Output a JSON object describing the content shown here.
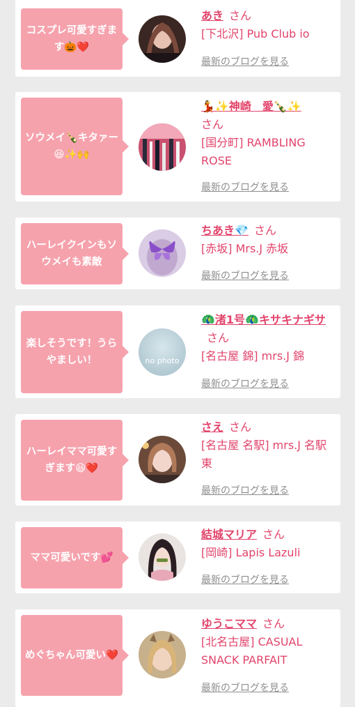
{
  "cards": [
    {
      "comment": "コスプレ可愛すぎます🎃❤️",
      "name": "あき",
      "san": "さん",
      "shop": "[下北沢] Pub Club io",
      "blog": "最新のブログを見る"
    },
    {
      "comment": "ソウメイ🍾キタァー😆✨🙌",
      "name": "💃✨神崎　愛🍾✨",
      "san": "さん",
      "shop": "[国分町] RAMBLING ROSE",
      "blog": "最新のブログを見る"
    },
    {
      "comment": "ハーレイクインもソウメイも素敵",
      "name": "ちあき💎",
      "san": "さん",
      "shop": "[赤坂] Mrs.J 赤坂",
      "blog": "最新のブログを見る"
    },
    {
      "comment": "楽しそうです！うらやましい！",
      "name": "🦚渚1号🦚キサキナギサ",
      "san": "さん",
      "shop": "[名古屋 錦] mrs.J 錦",
      "blog": "最新のブログを見る",
      "avatar_text": "no photo"
    },
    {
      "comment": "ハーレイママ可愛すぎます😆❤️",
      "name": "さえ",
      "san": "さん",
      "shop": "[名古屋 名駅] mrs.J 名駅東",
      "blog": "最新のブログを見る"
    },
    {
      "comment": "ママ可愛いです💕",
      "name": "結城マリア",
      "san": "さん",
      "shop": "[岡崎] Lapis Lazuli",
      "blog": "最新のブログを見る"
    },
    {
      "comment": "めぐちゃん可愛い❤️",
      "name": "ゆうこママ",
      "san": "さん",
      "shop": "[北名古屋] CASUAL SNACK PARFAIT",
      "blog": "最新のブログを見る"
    }
  ],
  "colors": {
    "accent": "#e2446b",
    "bubble": "#f6a2ad",
    "muted": "#8f8f8f",
    "background": "#ebebeb"
  }
}
